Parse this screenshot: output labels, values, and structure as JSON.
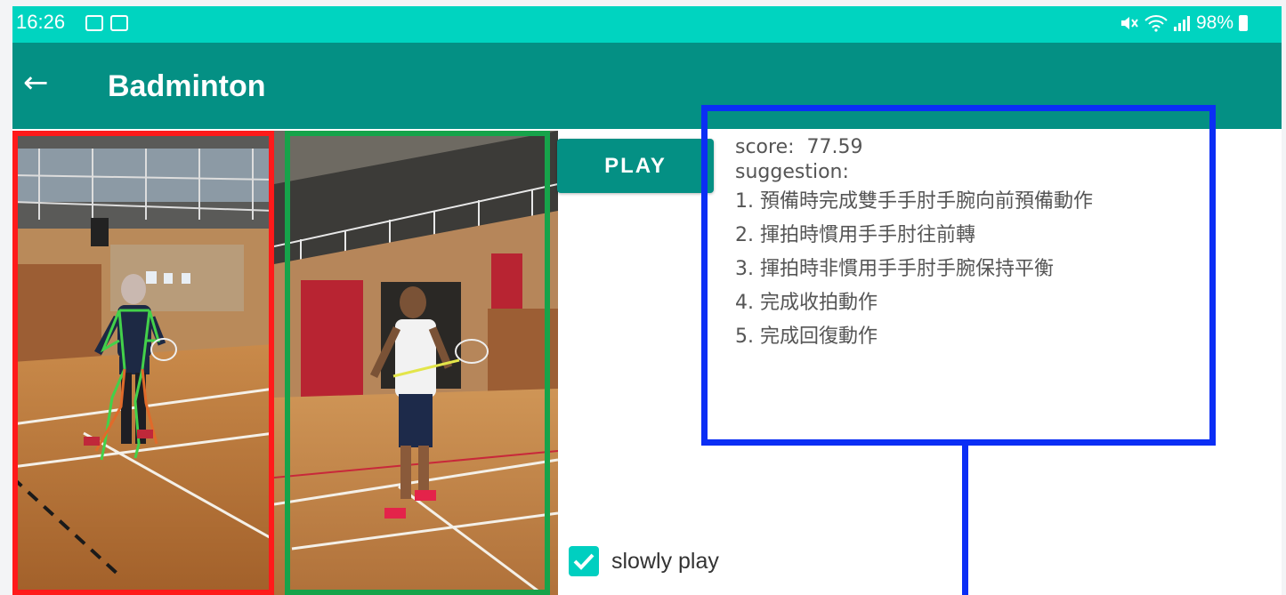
{
  "status_bar": {
    "time": "16:26",
    "battery": "98%",
    "icons": [
      "image-icon",
      "media-icon",
      "mute-icon",
      "wifi-icon",
      "signal-icon",
      "battery-icon"
    ]
  },
  "app_bar": {
    "title": "Badminton",
    "back_icon": "arrow-left-icon"
  },
  "controls": {
    "play_label": "PLAY",
    "slow_play_label": "slowly play",
    "slow_play_checked": true
  },
  "result": {
    "score_label": "score:",
    "score_value": "77.59",
    "suggestion_label": "suggestion:",
    "suggestions": [
      "1. 預備時完成雙手手肘手腕向前預備動作",
      "2. 揮拍時慣用手手肘往前轉",
      "3. 揮拍時非慣用手手肘手腕保持平衡",
      "4. 完成收拍動作",
      "5. 完成回復動作"
    ]
  },
  "colors": {
    "status_bar": "#00d4c0",
    "app_bar": "#049084",
    "highlight_user": "#ff1a1a",
    "highlight_reference": "#16a34a",
    "highlight_result": "#0b2ef5",
    "checkbox": "#00cfc0"
  }
}
